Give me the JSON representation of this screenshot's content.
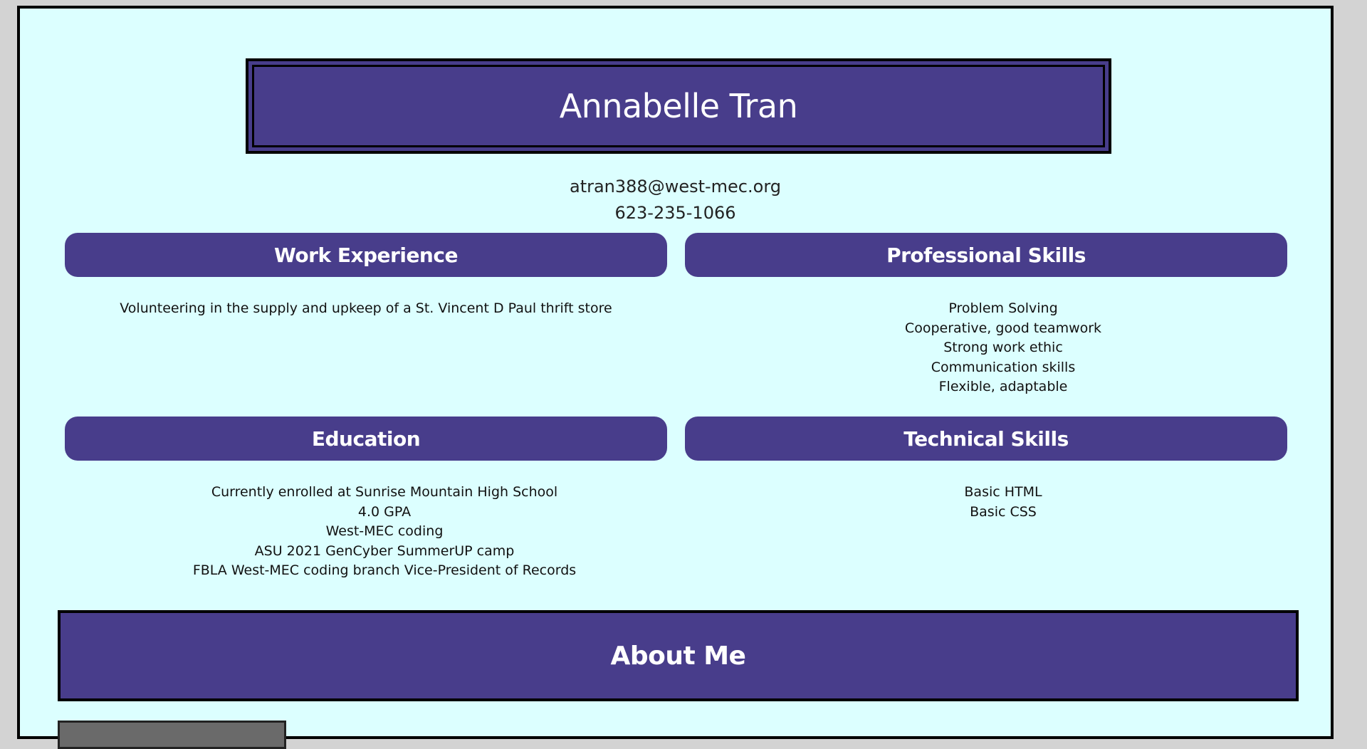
{
  "header": {
    "name": "Annabelle Tran",
    "email": "atran388@west-mec.org",
    "phone": "623-235-1066"
  },
  "sections": {
    "work_experience": {
      "title": "Work Experience",
      "items": [
        "Volunteering in the supply and upkeep of a St. Vincent D Paul thrift store"
      ]
    },
    "professional_skills": {
      "title": "Professional Skills",
      "items": [
        "Problem Solving",
        "Cooperative, good teamwork",
        "Strong work ethic",
        "Communication skills",
        "Flexible, adaptable"
      ]
    },
    "education": {
      "title": "Education",
      "items": [
        "Currently enrolled at Sunrise Mountain High School",
        "4.0 GPA",
        "West-MEC coding",
        "ASU 2021 GenCyber SummerUP camp",
        "FBLA West-MEC coding branch Vice-President of Records"
      ]
    },
    "technical_skills": {
      "title": "Technical Skills",
      "items": [
        "Basic HTML",
        "Basic CSS"
      ]
    }
  },
  "about": {
    "title": "About Me"
  },
  "colors": {
    "page_background": "#dcffff",
    "accent": "#483d8b",
    "outer_background": "#d3d3d3"
  }
}
